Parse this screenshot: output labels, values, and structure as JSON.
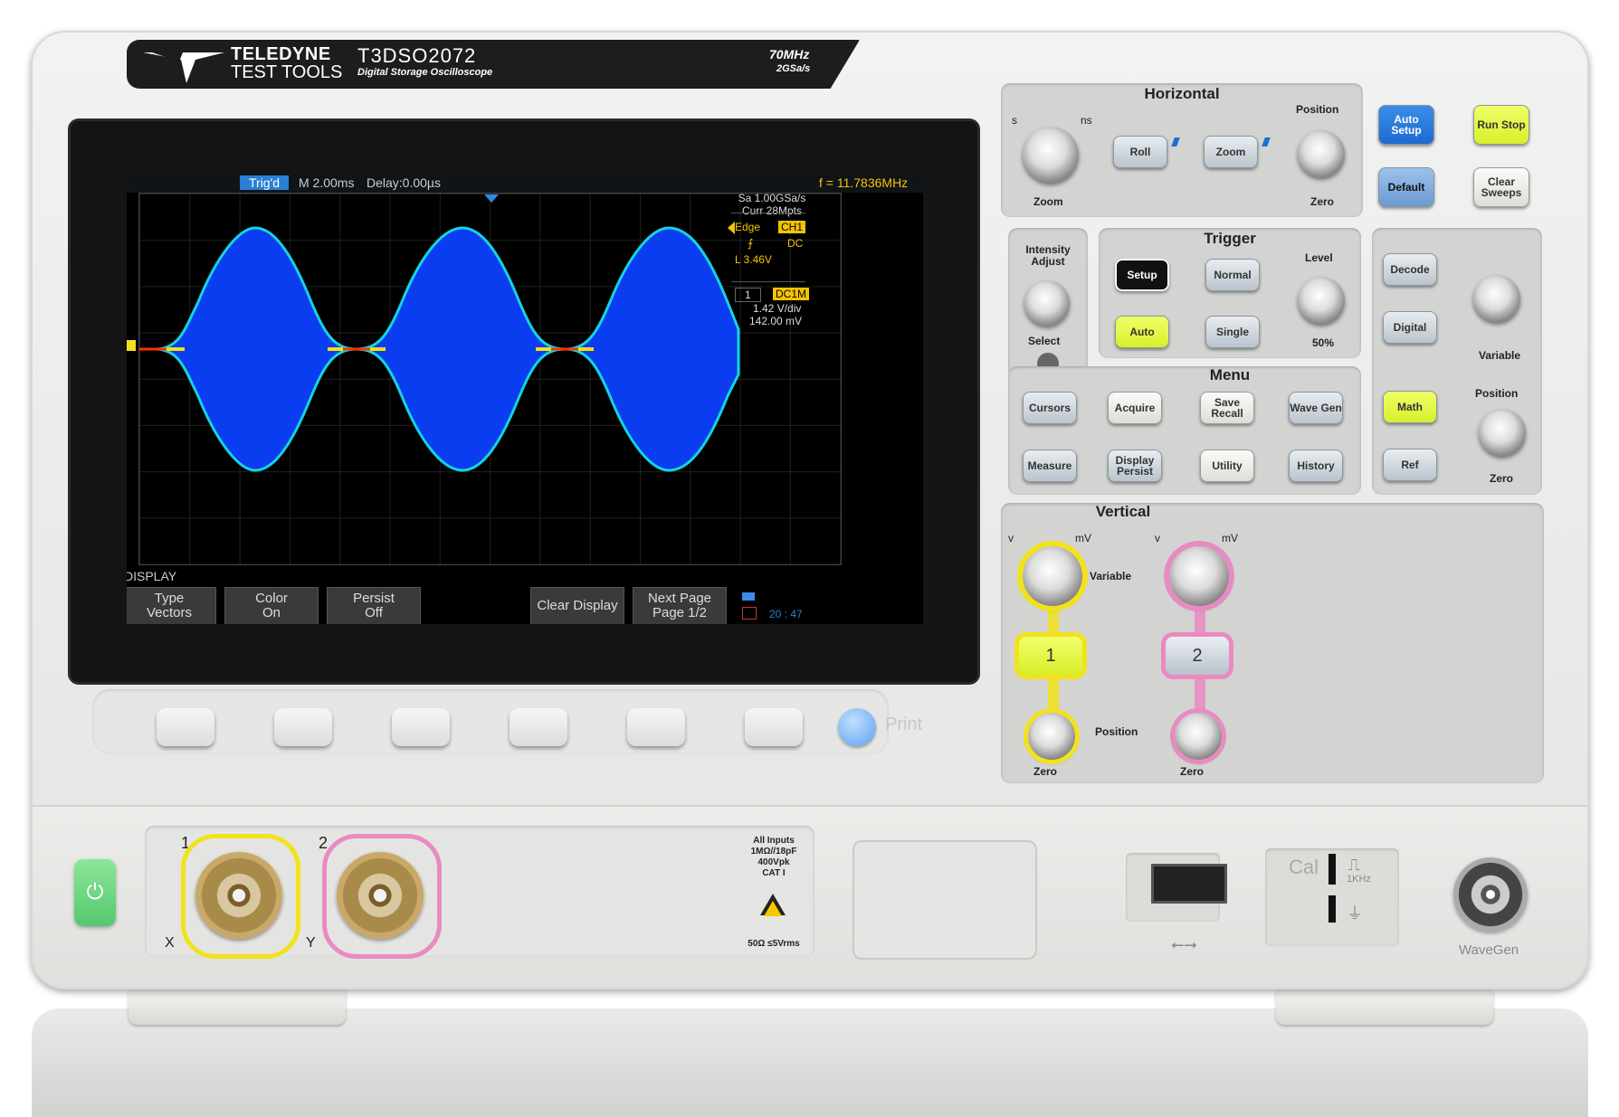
{
  "brand": {
    "line1": "TELEDYNE",
    "line2": "TEST TOOLS",
    "model": "T3DSO2072",
    "model_sub": "Digital Storage Oscilloscope",
    "bandwidth": "70MHz",
    "sample_rate": "2GSa/s"
  },
  "screen": {
    "trig_status": "Trig'd",
    "timebase": "M 2.00ms",
    "delay": "Delay:0.00µs",
    "freq": "f = 11.7836MHz",
    "sa": "Sa 1.00GSa/s",
    "curr": "Curr 28Mpts",
    "trigger_type": "Edge",
    "trigger_src": "CH1",
    "trigger_coupling": "DC",
    "trigger_level": "L  3.46V",
    "ch_num": "1",
    "ch_coupling": "DC1M",
    "ch_scale": "1.42 V/div",
    "ch_offset": "142.00 mV",
    "menu_title": "DISPLAY",
    "clock": "20 : 47",
    "softkeys": [
      {
        "line1": "Type",
        "line2": "Vectors"
      },
      {
        "line1": "Color",
        "line2": "On"
      },
      {
        "line1": "Persist",
        "line2": "Off"
      },
      {
        "line1": "Clear Display",
        "line2": ""
      },
      {
        "line1": "Next Page",
        "line2": "Page 1/2"
      }
    ]
  },
  "print_label": "Print",
  "horizontal": {
    "title": "Horizontal",
    "s": "s",
    "ns": "ns",
    "zoom_knob": "Zoom",
    "roll": "Roll",
    "zoom": "Zoom",
    "position": "Position",
    "zero": "Zero"
  },
  "top_keys": {
    "auto_setup": "Auto Setup",
    "run_stop": "Run Stop",
    "default": "Default",
    "clear_sweeps": "Clear Sweeps"
  },
  "intensity": {
    "title": "Intensity Adjust",
    "select": "Select"
  },
  "trigger": {
    "title": "Trigger",
    "setup": "Setup",
    "normal": "Normal",
    "auto": "Auto",
    "single": "Single",
    "level": "Level",
    "fifty": "50%"
  },
  "menu": {
    "title": "Menu",
    "cursors": "Cursors",
    "acquire": "Acquire",
    "save_recall": "Save Recall",
    "wave_gen": "Wave Gen",
    "measure": "Measure",
    "display_persist": "Display Persist",
    "utility": "Utility",
    "history": "History"
  },
  "right_panel": {
    "decode": "Decode",
    "digital": "Digital",
    "variable": "Variable",
    "math": "Math",
    "ref": "Ref",
    "position": "Position",
    "zero": "Zero"
  },
  "vertical": {
    "title": "Vertical",
    "v1": "v",
    "mv1": "mV",
    "v2": "v",
    "mv2": "mV",
    "variable": "Variable",
    "ch1": "1",
    "ch2": "2",
    "position": "Position",
    "zero1": "Zero",
    "zero2": "Zero"
  },
  "inputs": {
    "ch1": "1",
    "ch2": "2",
    "x": "X",
    "y": "Y",
    "info1": "All Inputs",
    "info2": "1MΩ//18pF",
    "info3": "400Vpk",
    "info4": "CAT I",
    "info5": "50Ω ≤5Vrms"
  },
  "cal": {
    "label": "Cal",
    "freq": "1KHz"
  },
  "wavegen_label": "WaveGen",
  "colors": {
    "ch1": "#f2e21c",
    "ch2": "#e98ac2",
    "accent_blue": "#1f6fd6",
    "screen_bg": "#000000"
  }
}
